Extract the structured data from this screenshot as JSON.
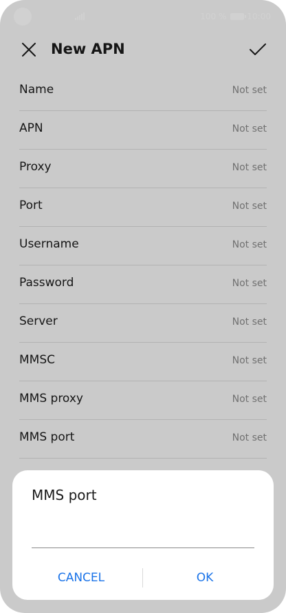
{
  "status": {
    "battery_percent": "100 %",
    "time": "10:00"
  },
  "app_bar": {
    "title": "New APN"
  },
  "fields": [
    {
      "label": "Name",
      "value": "Not set"
    },
    {
      "label": "APN",
      "value": "Not set"
    },
    {
      "label": "Proxy",
      "value": "Not set"
    },
    {
      "label": "Port",
      "value": "Not set"
    },
    {
      "label": "Username",
      "value": "Not set"
    },
    {
      "label": "Password",
      "value": "Not set"
    },
    {
      "label": "Server",
      "value": "Not set"
    },
    {
      "label": "MMSC",
      "value": "Not set"
    },
    {
      "label": "MMS proxy",
      "value": "Not set"
    },
    {
      "label": "MMS port",
      "value": "Not set"
    }
  ],
  "dialog": {
    "title": "MMS port",
    "input_value": "",
    "cancel_label": "CANCEL",
    "ok_label": "OK"
  },
  "colors": {
    "accent": "#1a73e8",
    "background": "#f7f7f7",
    "dim_overlay": "rgba(0,0,0,0.18)"
  },
  "icons": {
    "close": "close-icon",
    "confirm": "check-icon",
    "signal": "signal-icon",
    "battery": "battery-icon",
    "camera": "camera-cutout"
  }
}
